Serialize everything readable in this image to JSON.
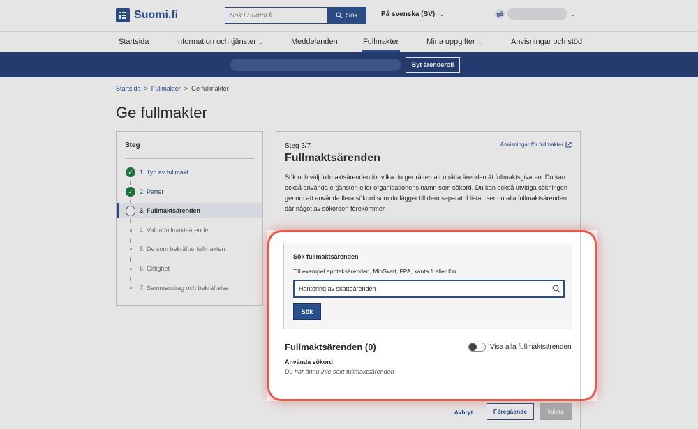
{
  "header": {
    "logo_text": "Suomi.fi",
    "search_placeholder": "Sök i Suomi.fi",
    "search_button": "Sök",
    "language": "På svenska (SV)",
    "user_initials": "gå"
  },
  "nav": {
    "items": [
      {
        "label": "Startsida"
      },
      {
        "label": "Information och tjänster",
        "has_dropdown": true
      },
      {
        "label": "Meddelanden"
      },
      {
        "label": "Fullmakter",
        "active": true
      },
      {
        "label": "Mina uppgifter",
        "has_dropdown": true
      },
      {
        "label": "Anvisningar och stöd"
      }
    ]
  },
  "role_band": {
    "button": "Byt ärenderoll"
  },
  "breadcrumb": {
    "home": "Startsida",
    "section": "Fullmakter",
    "current": "Ge fullmakter",
    "sep": ">"
  },
  "page": {
    "title": "Ge fullmakter"
  },
  "steps": {
    "title": "Steg",
    "items": [
      {
        "label": "1. Typ av fullmakt",
        "state": "done"
      },
      {
        "label": "2. Parter",
        "state": "done"
      },
      {
        "label": "3. Fullmaktsärenden",
        "state": "current"
      },
      {
        "label": "4. Valda fullmaktsärenden",
        "state": "todo"
      },
      {
        "label": "5. De som bekräftar fullmakten",
        "state": "todo"
      },
      {
        "label": "6. Giltighet",
        "state": "todo"
      },
      {
        "label": "7. Sammandrag och bekräftelse",
        "state": "todo"
      }
    ]
  },
  "content": {
    "step_count": "Steg 3/7",
    "help_link": "Anvisningar för fullmakter",
    "title": "Fullmaktsärenden",
    "intro": "Sök och välj fullmaktsärenden för vilka du ger rätten att uträtta ärenden åt fullmaktsgivaren. Du kan också använda e-tjänsten eller organisationens namn som sökord. Du kan också utvidga sökningen genom att använda flera sökord som du lägger till dem separat. I listan ser du alla fullmaktsärenden där något av sökorden förekommer."
  },
  "search_box": {
    "title": "Sök fullmaktsärenden",
    "hint": "Till exempel apoteksärenden, MinSkatt, FPA, kanta.fi eller lön",
    "value": "Hantering av skatteärenden",
    "button": "Sök"
  },
  "results": {
    "title": "Fullmaktsärenden (0)",
    "toggle_label": "Visa alla fullmaktsärenden",
    "toggle_on": false,
    "used_label": "Använda sökord",
    "used_value": "Du har ännu inte sökt fullmaktsärenden"
  },
  "actions": {
    "cancel": "Avbryt",
    "previous": "Föregående",
    "next": "Nästa"
  },
  "colors": {
    "brand": "#2a4f8f",
    "band": "#233e77",
    "done": "#1f7a3c",
    "highlight": "#e25b4c"
  }
}
